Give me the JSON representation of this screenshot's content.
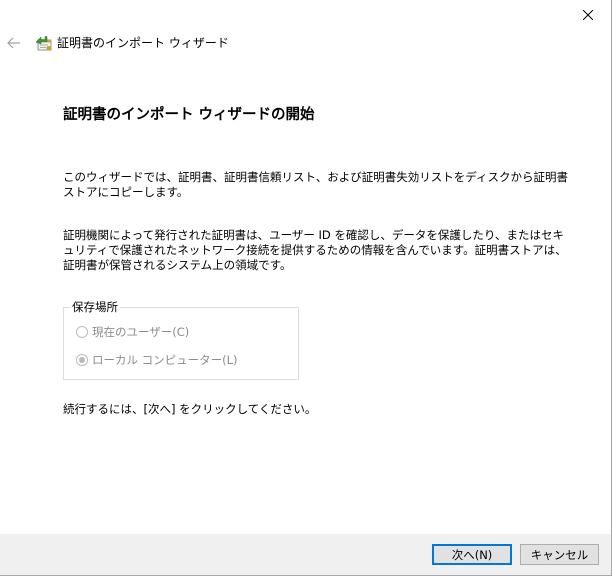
{
  "window": {
    "close_icon": "close-icon"
  },
  "header": {
    "back_icon": "back-arrow-icon",
    "app_icon": "certificate-import-icon",
    "title": "証明書のインポート ウィザード"
  },
  "main": {
    "page_title": "証明書のインポート ウィザードの開始",
    "paragraph1": "このウィザードでは、証明書、証明書信頼リスト、および証明書失効リストをディスクから証明書ストアにコピーします。",
    "paragraph2": "証明機関によって発行された証明書は、ユーザー ID を確認し、データを保護したり、またはセキュリティで保護されたネットワーク接続を提供するための情報を含んでいます。証明書ストアは、証明書が保管されるシステム上の領域です。",
    "store_location": {
      "legend": "保存場所",
      "options": [
        {
          "label": "現在のユーザー(C)",
          "checked": false,
          "disabled": true
        },
        {
          "label": "ローカル コンピューター(L)",
          "checked": true,
          "disabled": true
        }
      ]
    },
    "paragraph3": "続行するには、[次へ] をクリックしてください。"
  },
  "footer": {
    "next_label": "次へ(N)",
    "cancel_label": "キャンセル"
  },
  "colors": {
    "footer_bg": "#f0f0f0",
    "button_bg": "#e1e1e1",
    "default_button_border": "#0078d7",
    "disabled_text": "#8c8c8c"
  }
}
